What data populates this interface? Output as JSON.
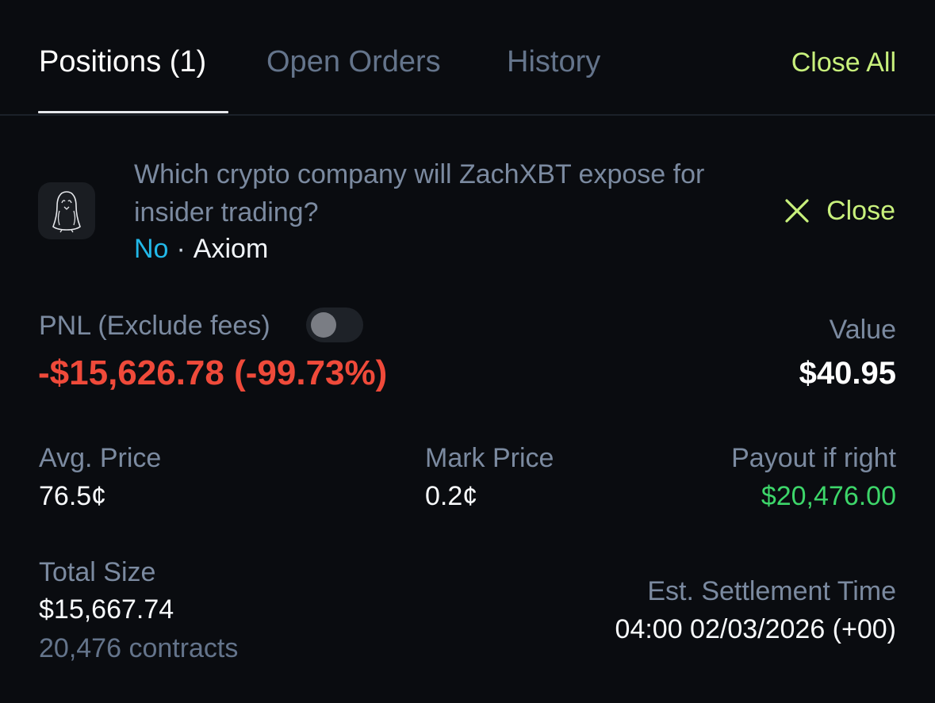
{
  "tabs": [
    {
      "label": "Positions (1)",
      "active": true
    },
    {
      "label": "Open Orders",
      "active": false
    },
    {
      "label": "History",
      "active": false
    }
  ],
  "close_all_label": "Close All",
  "position": {
    "market_icon": "penguin-ghost-icon",
    "title": "Which crypto company will ZachXBT expose for insider trading?",
    "side": "No",
    "separator": "·",
    "outcome": "Axiom",
    "close_label": "Close",
    "pnl_label": "PNL (Exclude fees)",
    "exclude_fees_toggle": false,
    "pnl_value": "-$15,626.78 (-99.73%)",
    "value_label": "Value",
    "value": "$40.95",
    "avg_price_label": "Avg. Price",
    "avg_price": "76.5¢",
    "mark_price_label": "Mark Price",
    "mark_price": "0.2¢",
    "payout_label": "Payout if right",
    "payout": "$20,476.00",
    "total_size_label": "Total Size",
    "total_size": "$15,667.74",
    "contracts": "20,476 contracts",
    "settlement_label": "Est. Settlement Time",
    "settlement_time": "04:00 02/03/2026 (+00)"
  },
  "colors": {
    "background": "#0a0c10",
    "accent": "#c8f07c",
    "loss": "#ef4a3a",
    "gain": "#3dd66a",
    "side_no": "#22b8e8",
    "muted": "#7b8aa0"
  }
}
